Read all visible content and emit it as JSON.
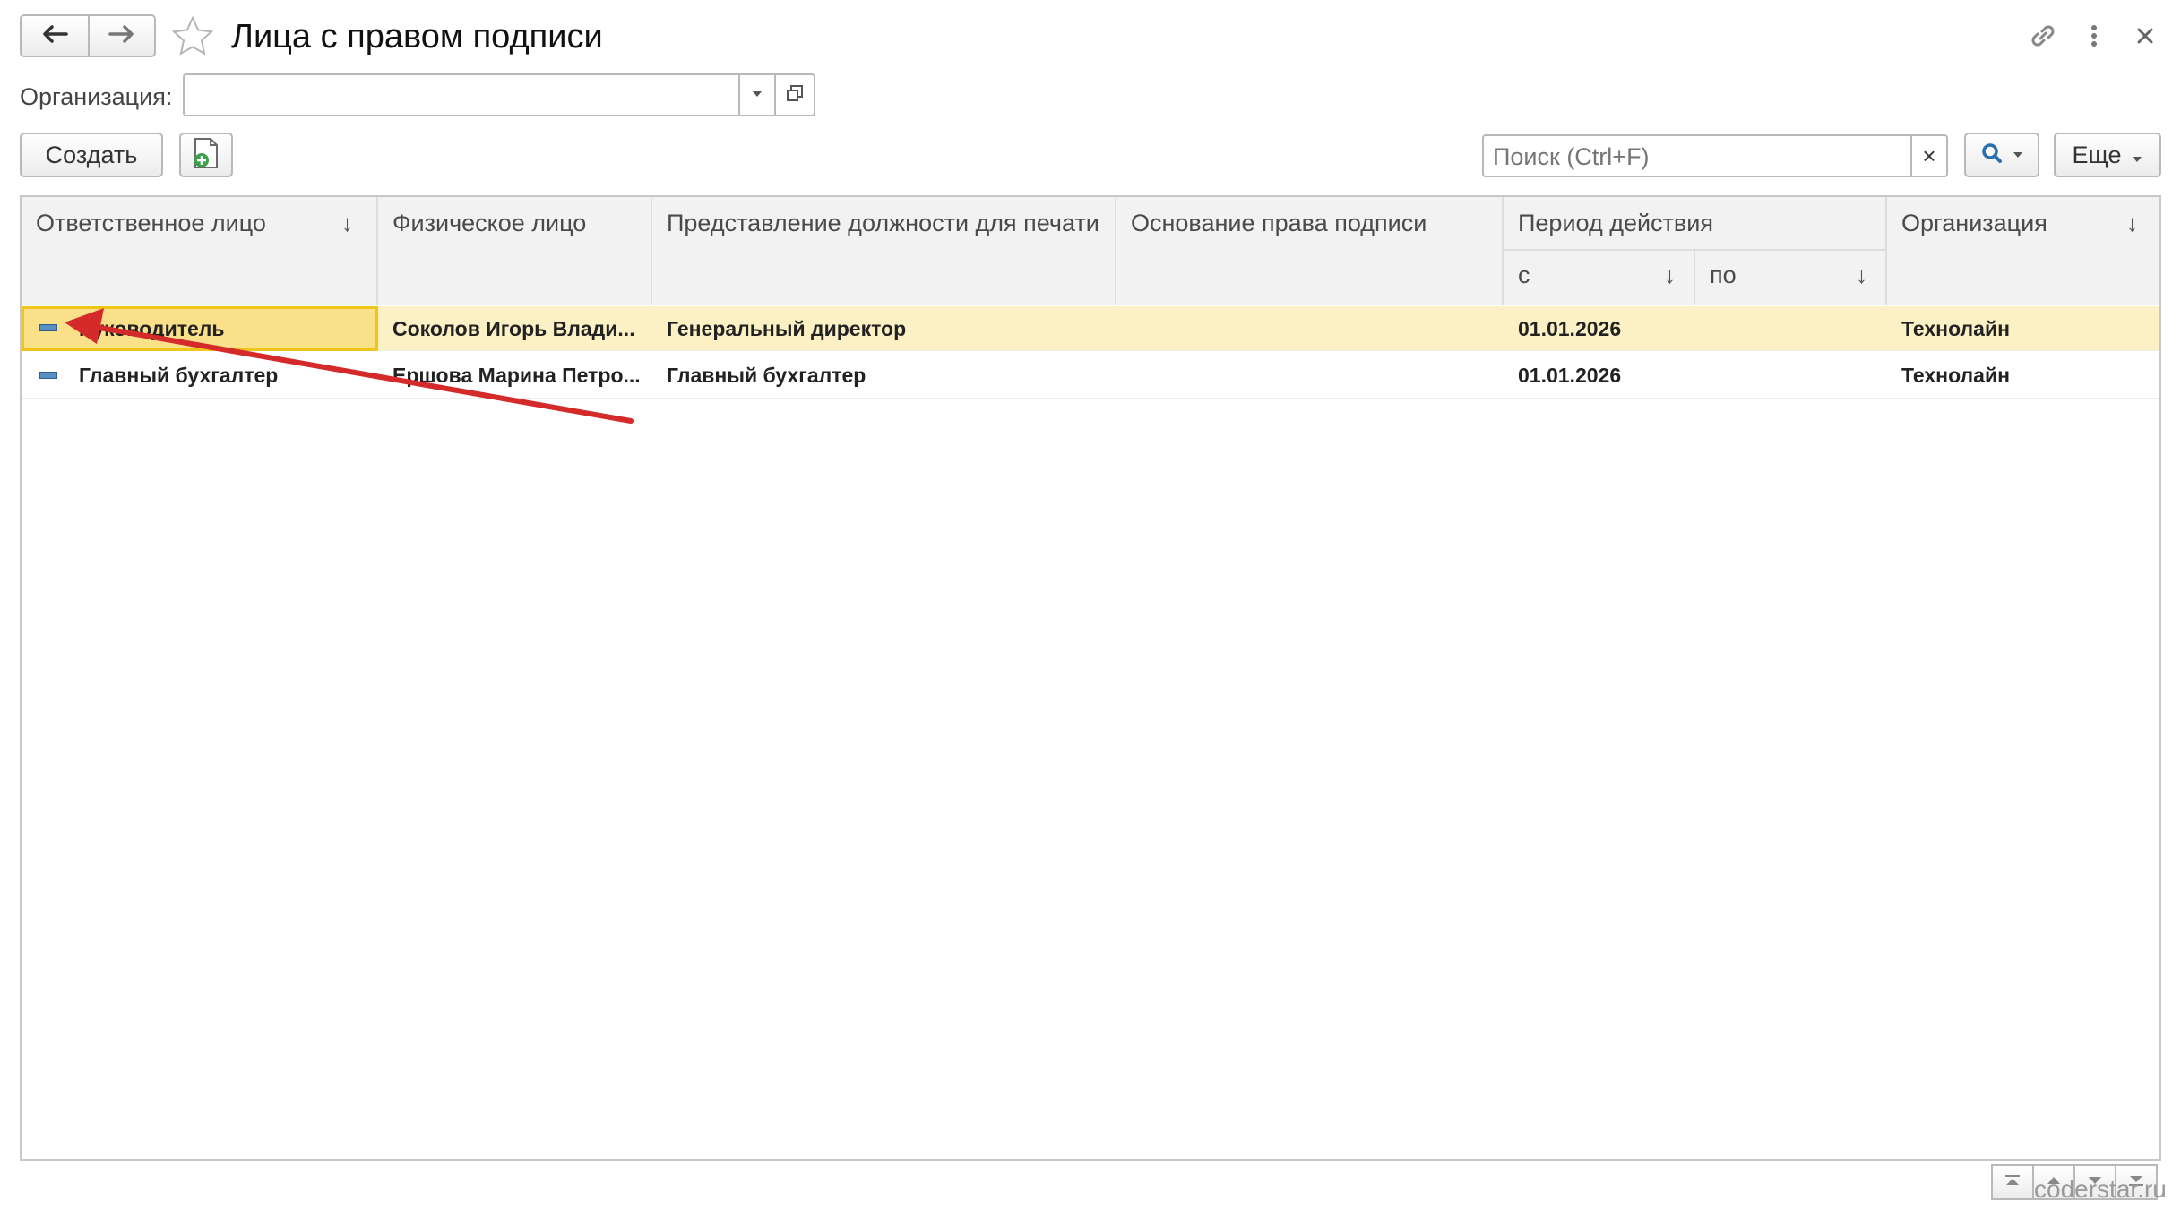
{
  "header": {
    "title": "Лица с правом подписи",
    "back_icon": "arrow-left-icon",
    "forward_icon": "arrow-right-icon",
    "favorite_icon": "star-icon",
    "link_icon": "link-icon",
    "more_icon": "more-vertical-icon",
    "close_icon": "close-icon"
  },
  "filter": {
    "label": "Организация:",
    "value": ""
  },
  "toolbar": {
    "create_label": "Создать",
    "search_placeholder": "Поиск (Ctrl+F)",
    "search_clear": "×",
    "more_label": "Еще"
  },
  "table": {
    "headers": {
      "responsible": "Ответственное лицо",
      "person": "Физическое лицо",
      "position": "Представление должности для печати",
      "basis": "Основание права подписи",
      "period": "Период действия",
      "period_from": "с",
      "period_to": "по",
      "organization": "Организация",
      "sort_arrow": "↓"
    },
    "rows": [
      {
        "responsible": "Руководитель",
        "person": "Соколов Игорь Влади...",
        "position": "Генеральный директор",
        "basis": "",
        "from": "01.01.2026",
        "to": "",
        "organization": "Технолайн"
      },
      {
        "responsible": "Главный бухгалтер",
        "person": "Ершова Марина Петро...",
        "position": "Главный бухгалтер",
        "basis": "",
        "from": "01.01.2026",
        "to": "",
        "organization": "Технолайн"
      }
    ],
    "selected_row": 0
  },
  "annotation": {
    "arrow_color": "#d42a2a"
  },
  "colors": {
    "selected_row": "#fcf1c4",
    "selected_cell": "#fbe08a",
    "selected_border": "#f0c419",
    "accent_blue": "#2a6fb0"
  },
  "watermark": "coderstar.ru"
}
